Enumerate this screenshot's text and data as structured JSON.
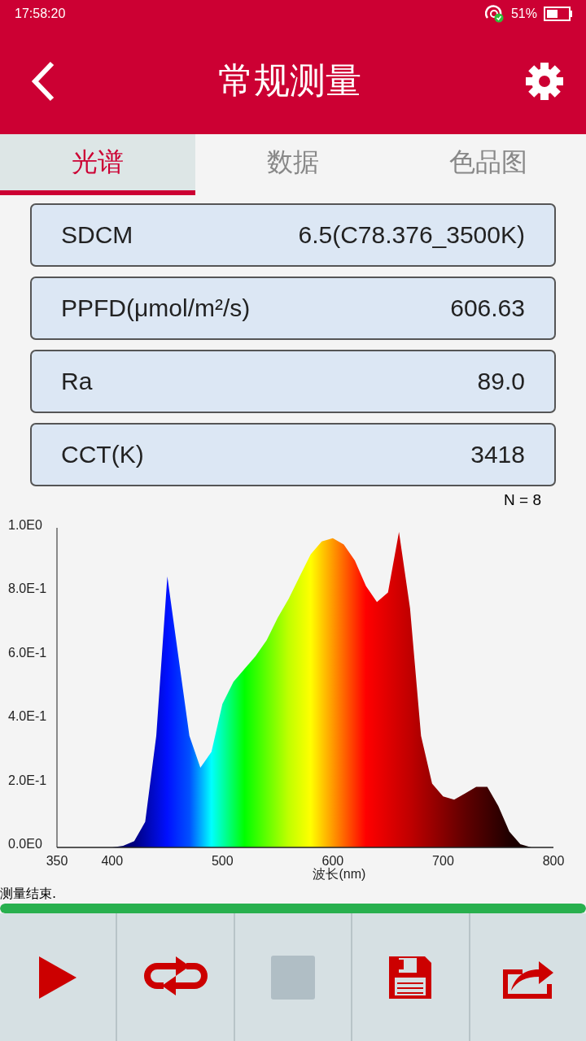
{
  "status_bar": {
    "time": "17:58:20",
    "battery": "51%"
  },
  "header": {
    "title": "常规测量"
  },
  "tabs": [
    {
      "label": "光谱",
      "selected": true
    },
    {
      "label": "数据",
      "selected": false
    },
    {
      "label": "色品图",
      "selected": false
    }
  ],
  "metrics": [
    {
      "label": "SDCM",
      "value": "6.5(C78.376_3500K)"
    },
    {
      "label": "PPFD(μmol/m²/s)",
      "value": "606.63"
    },
    {
      "label": "Ra",
      "value": "89.0"
    },
    {
      "label": "CCT(K)",
      "value": "3418"
    }
  ],
  "count": "N = 8",
  "spectrum": {
    "chart_data": {
      "type": "area",
      "xlabel": "波长(nm)",
      "x": [
        350,
        360,
        370,
        380,
        390,
        400,
        410,
        420,
        430,
        440,
        450,
        460,
        470,
        480,
        490,
        500,
        510,
        520,
        530,
        540,
        550,
        560,
        570,
        580,
        590,
        600,
        610,
        620,
        630,
        640,
        650,
        660,
        670,
        680,
        690,
        700,
        710,
        720,
        730,
        740,
        750,
        760,
        770,
        780,
        790,
        800
      ],
      "values": [
        0,
        0,
        0,
        0,
        0,
        0,
        0.005,
        0.02,
        0.08,
        0.35,
        0.85,
        0.6,
        0.35,
        0.25,
        0.3,
        0.45,
        0.52,
        0.56,
        0.6,
        0.65,
        0.72,
        0.78,
        0.85,
        0.92,
        0.96,
        0.97,
        0.95,
        0.9,
        0.82,
        0.77,
        0.8,
        0.99,
        0.75,
        0.35,
        0.2,
        0.16,
        0.15,
        0.17,
        0.19,
        0.19,
        0.13,
        0.05,
        0.01,
        0,
        0,
        0
      ],
      "xlim": [
        350,
        800
      ],
      "ylim": [
        0,
        1
      ],
      "xticks": [
        350,
        400,
        500,
        600,
        700,
        800
      ],
      "yticks": [
        {
          "value": 0,
          "label": "0.0E0"
        },
        {
          "value": 0.2,
          "label": "2.0E-1"
        },
        {
          "value": 0.4,
          "label": "4.0E-1"
        },
        {
          "value": 0.6,
          "label": "6.0E-1"
        },
        {
          "value": 0.8,
          "label": "8.0E-1"
        },
        {
          "value": 1,
          "label": "1.0E0"
        }
      ]
    }
  },
  "message": "测量结束.",
  "progress": {
    "level": 1
  },
  "toolbar": [
    {
      "kind": "play",
      "disabled": false
    },
    {
      "kind": "loop",
      "disabled": false
    },
    {
      "kind": "stop",
      "disabled": true
    },
    {
      "kind": "save",
      "disabled": false
    },
    {
      "kind": "export",
      "disabled": false
    }
  ]
}
